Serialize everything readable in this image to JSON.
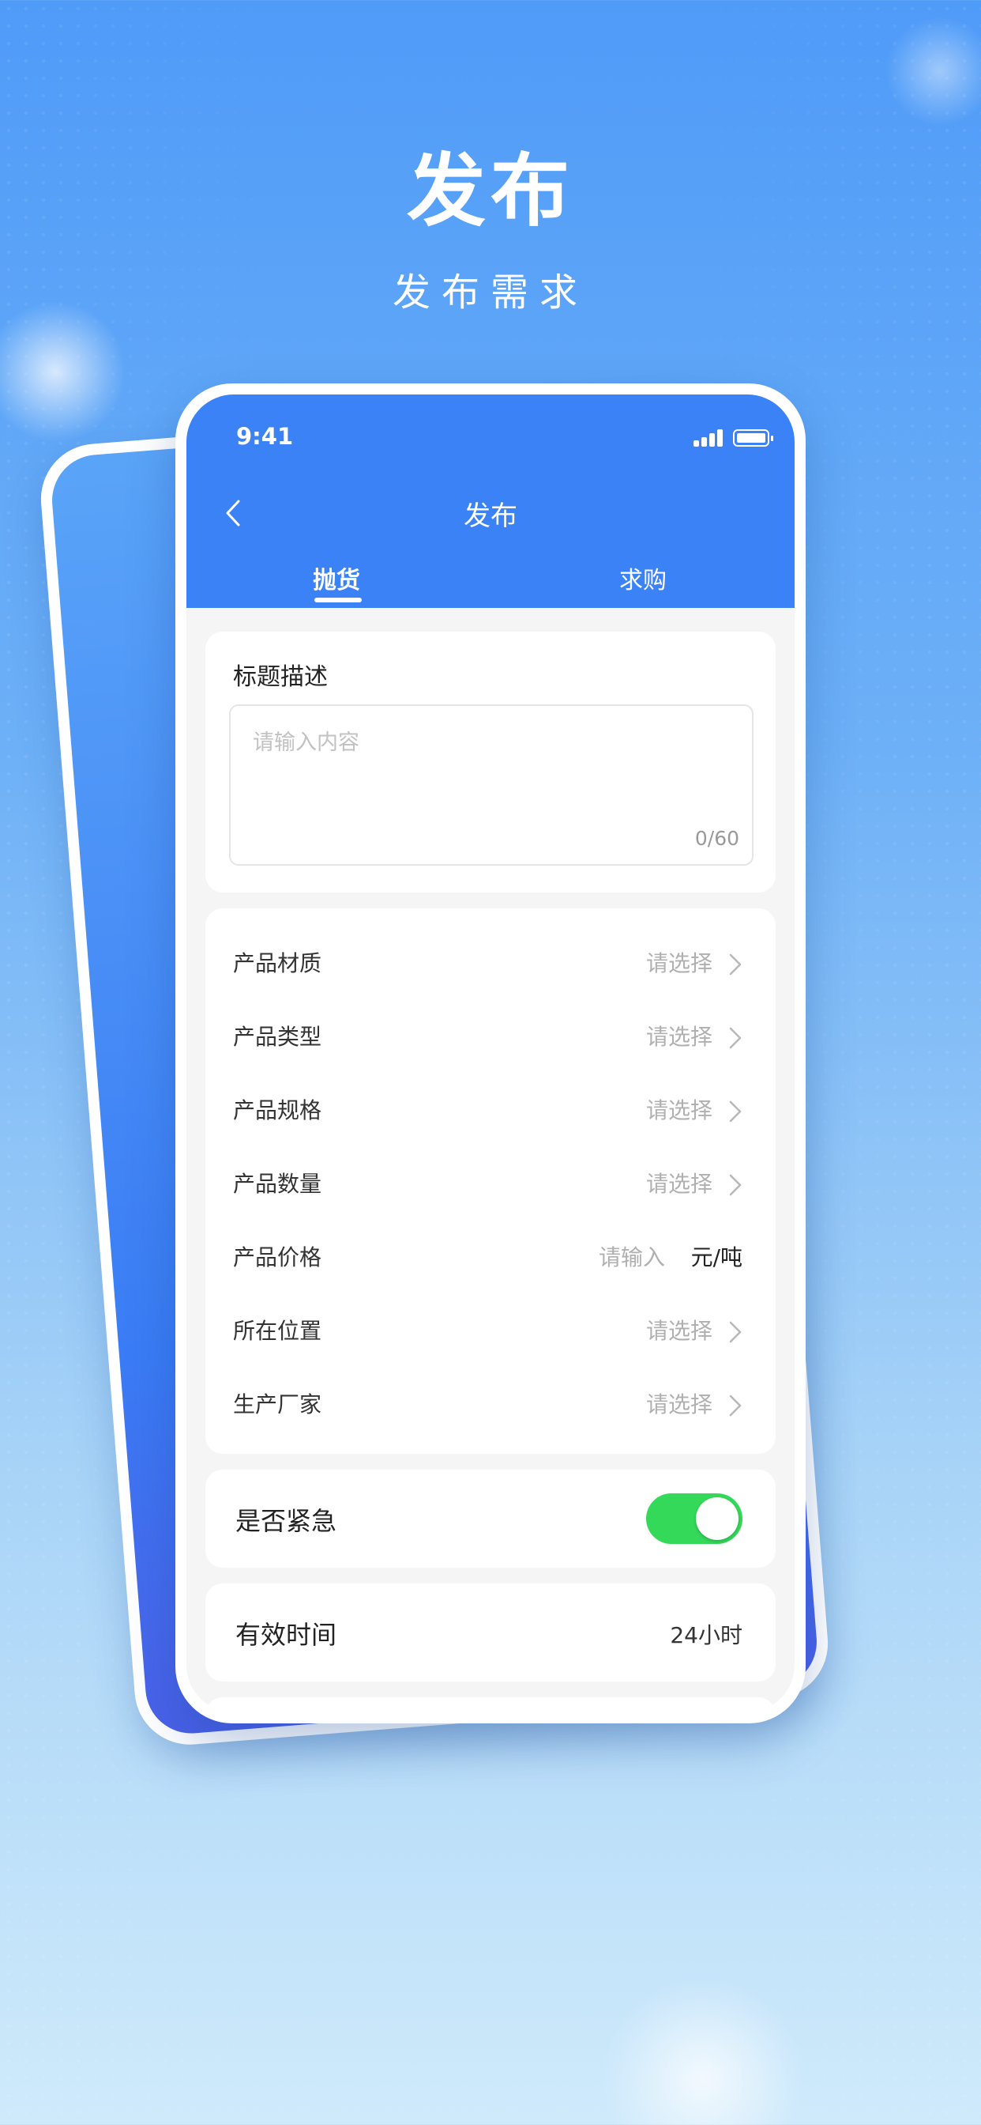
{
  "hero": {
    "title": "发布",
    "subtitle": "发布需求"
  },
  "status_bar": {
    "time": "9:41"
  },
  "nav": {
    "title": "发布"
  },
  "tabs": [
    {
      "label": "抛货",
      "active": true
    },
    {
      "label": "求购",
      "active": false
    }
  ],
  "title_section": {
    "label": "标题描述",
    "placeholder": "请输入内容",
    "counter": "0/60"
  },
  "form_rows": [
    {
      "label": "产品材质",
      "value": "请选择"
    },
    {
      "label": "产品类型",
      "value": "请选择"
    },
    {
      "label": "产品规格",
      "value": "请选择"
    },
    {
      "label": "产品数量",
      "value": "请选择"
    },
    {
      "label": "产品价格",
      "placeholder": "请输入",
      "unit": "元/吨"
    },
    {
      "label": "所在位置",
      "value": "请选择"
    },
    {
      "label": "生产厂家",
      "value": "请选择"
    }
  ],
  "urgent": {
    "label": "是否紧急",
    "enabled": true
  },
  "valid_time": {
    "label": "有效时间",
    "value": "24小时"
  },
  "colors": {
    "primary": "#3b82f6",
    "toggle_on": "#35d95a"
  }
}
